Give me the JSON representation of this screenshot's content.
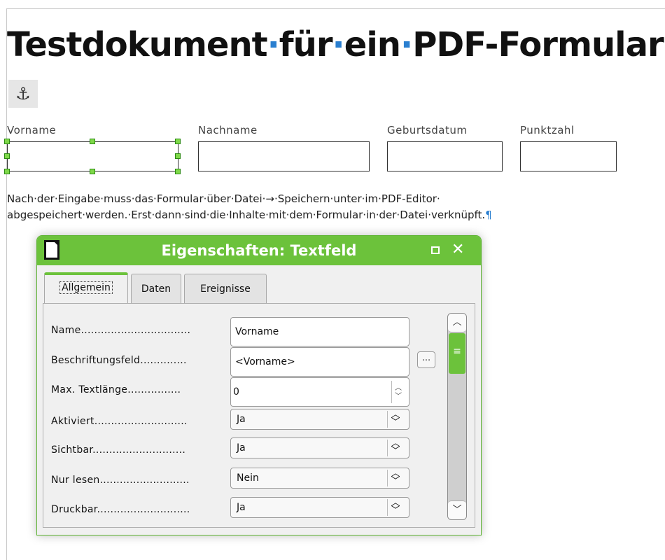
{
  "document": {
    "title_words": [
      "Testdokument",
      "für",
      "ein",
      "PDF-Formular"
    ],
    "paragraph_mark": "¶",
    "space_mark": "·",
    "anchor_icon": "anchor-icon",
    "fields": [
      {
        "label": "Vorname"
      },
      {
        "label": "Nachname"
      },
      {
        "label": "Geburtsdatum"
      },
      {
        "label": "Punktzahl"
      }
    ],
    "paragraph_line1": "Nach·der·Eingabe·muss·das·Formular·über·Datei·→·Speichern·unter·im·PDF-Editor·",
    "paragraph_line2": "abgespeichert·werden.·Erst·dann·sind·die·Inhalte·mit·dem·Formular·in·der·Datei·verknüpft.",
    "paragraph_line2_mark": "¶"
  },
  "dialog": {
    "title": "Eigenschaften: Textfeld",
    "tabs": [
      "Allgemein",
      "Daten",
      "Ereignisse"
    ],
    "active_tab": "Allgemein",
    "ellipsis_label": "...",
    "properties": {
      "name": {
        "label": "Name.................................",
        "value": "Vorname"
      },
      "label_field": {
        "label": "Beschriftungsfeld..............",
        "value": "<Vorname>"
      },
      "max_length": {
        "label": "Max. Textlänge................",
        "value": "0"
      },
      "enabled": {
        "label": "Aktiviert............................",
        "value": "Ja"
      },
      "visible": {
        "label": "Sichtbar............................",
        "value": "Ja"
      },
      "read_only": {
        "label": "Nur lesen...........................",
        "value": "Nein"
      },
      "printable": {
        "label": "Druckbar............................",
        "value": "Ja"
      }
    }
  },
  "colors": {
    "accent": "#6cc23b",
    "formatting_marks": "#2a7fd0"
  }
}
